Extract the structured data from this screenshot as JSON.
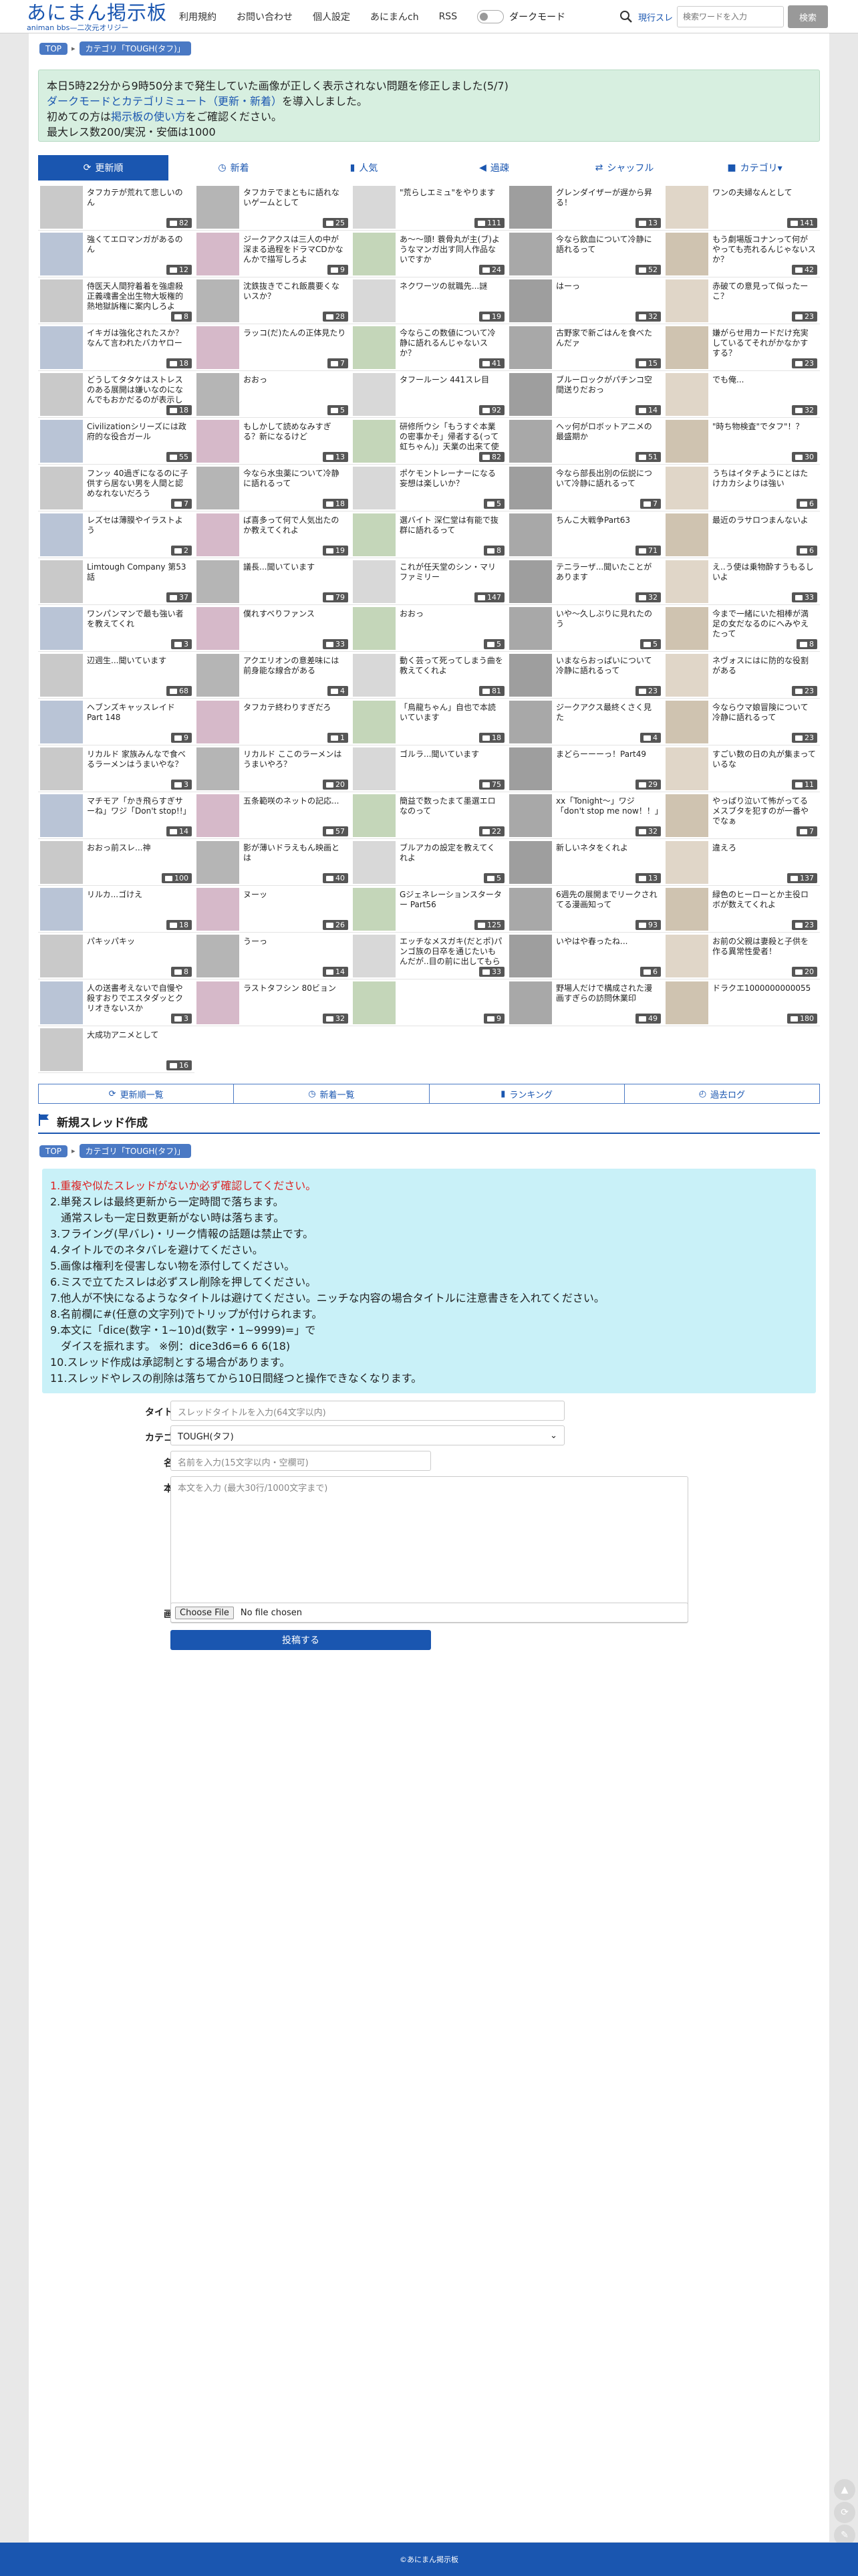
{
  "header": {
    "logo_title": "あにまん掲示板",
    "logo_subtitle": "animan bbs—二次元オリジー",
    "nav": [
      {
        "label": "利用規約"
      },
      {
        "label": "お問い合わせ"
      },
      {
        "label": "個人設定"
      },
      {
        "label": "あにまんch"
      },
      {
        "label": "RSS"
      }
    ],
    "darkmode_label": "ダークモード",
    "search": {
      "scope_label": "現行スレ",
      "placeholder": "検索ワードを入力",
      "button_label": "検索"
    }
  },
  "breadcrumb": {
    "top": "TOP",
    "category": "カテゴリ「TOUGH(タフ)」"
  },
  "notice": {
    "line1": "本日5時22分から9時50分まで発生していた画像が正しく表示されない問題を修正しました(5/7)",
    "line2_link": "ダークモードとカテゴリミュート（更新・新着）",
    "line2_text": "を導入しました。",
    "line3_pre": "初めての方は",
    "line3_link": "掲示板の使い方",
    "line3_post": "をご確認ください。",
    "line4": "最大レス数200/実況・安価は1000"
  },
  "tabs": [
    {
      "label": "更新順",
      "icon": "refresh-icon"
    },
    {
      "label": "新着",
      "icon": "clock-icon"
    },
    {
      "label": "人気",
      "icon": "bar-chart-icon"
    },
    {
      "label": "過疎",
      "icon": "speaker-icon"
    },
    {
      "label": "シャッフル",
      "icon": "shuffle-icon"
    },
    {
      "label": "カテゴリ▾",
      "icon": "folder-icon"
    }
  ],
  "threads": [
    {
      "title": "タフカテが荒れて悲しいのん",
      "count": "82"
    },
    {
      "title": "タフカテでまともに語れないゲームとして",
      "count": "25"
    },
    {
      "title": "\"荒らしエミュ\"をやります",
      "count": "111"
    },
    {
      "title": "グレンダイザーが遅から昇る！",
      "count": "13"
    },
    {
      "title": "ワンの夫婦なんとして",
      "count": "141"
    },
    {
      "title": "強くてエロマンガがあるのん",
      "count": "12"
    },
    {
      "title": "ジークアクスは三人の中が深まる過程をドラマCDかなんかで描写しろよ",
      "count": "9"
    },
    {
      "title": "あ～～頭! 蓑骨丸が主(ブ)ようなマンガ出す同人作品ないですか",
      "count": "24"
    },
    {
      "title": "今なら飲血について冷静に語れるって",
      "count": "52"
    },
    {
      "title": "もう劇場版コナンって何がやっても売れるんじゃないスか？",
      "count": "42"
    },
    {
      "title": "侍医天人間狩着着を強虐殺正義魂書全出生物大坂権的熱地獄訴権に案内しろよ",
      "count": "8"
    },
    {
      "title": "沈鉄抜きでこれ飯農要くないスか？",
      "count": "28"
    },
    {
      "title": "ネクワーツの就職先...謎",
      "count": "19"
    },
    {
      "title": "はーっ",
      "count": "32"
    },
    {
      "title": "赤破ての意見って似ったーこ？",
      "count": "23"
    },
    {
      "title": "イキガは強化されたスか？なんて言われたバカヤロー",
      "count": "18"
    },
    {
      "title": "ラッコ(だ)たんの正体見たり",
      "count": "7"
    },
    {
      "title": "今ならこの数値について冷静に語れるんじゃないスか？",
      "count": "41"
    },
    {
      "title": "古野家で新ごはんを食べたんだァ",
      "count": "15"
    },
    {
      "title": "嫌がらせ用カードだけ充実しているてそれがかなかすする？",
      "count": "23"
    },
    {
      "title": "どうしてタタケはストレスのある展開は嫌いなのになんでもおかだるのが表示してくれる",
      "count": "18"
    },
    {
      "title": "おおっ",
      "count": "5"
    },
    {
      "title": "タフールーン 441スレ目",
      "count": "92"
    },
    {
      "title": "ブルーロックがパチンコ空間送りだおっ",
      "count": "14"
    },
    {
      "title": "でも俺...",
      "count": "32"
    },
    {
      "title": "Civilizationシリーズには政府的な役合ガール",
      "count": "55"
    },
    {
      "title": "もしかして読めなみすぎる？新になるけど",
      "count": "13"
    },
    {
      "title": "研修所ウシ「もうすぐ本業の密事かそ」帰者する(って虹ちゃん)」天業の出来て使用結業ガーて...",
      "count": "82"
    },
    {
      "title": "ヘッ何がロボットアニメの最盛期か",
      "count": "51"
    },
    {
      "title": "\"時ち物検査\"でタフ\"！？",
      "count": "30"
    },
    {
      "title": "フンッ 40過ぎになるのに子供すら居ない男を人間と認めなれないだろう",
      "count": "7"
    },
    {
      "title": "今なら水虫薬について冷静に語れるって",
      "count": "18"
    },
    {
      "title": "ポケモントレーナーになる妄想は楽しいか？",
      "count": "5"
    },
    {
      "title": "今なら部長出別の伝説について冷静に語れるって",
      "count": "7"
    },
    {
      "title": "うちはイタチようにとはたけカカシよりは強い",
      "count": "6"
    },
    {
      "title": "レズセは薄膜やイラストよう",
      "count": "2"
    },
    {
      "title": "ぱ喜多って何で人気出たのか教えてくれよ",
      "count": "19"
    },
    {
      "title": "選バイト 深仁堂は有能で抜群に語れるって",
      "count": "8"
    },
    {
      "title": "ちんこ大戦争Part63",
      "count": "71"
    },
    {
      "title": "最近のラサロつまんないよ",
      "count": "6"
    },
    {
      "title": "Limtough Company 第53話",
      "count": "37"
    },
    {
      "title": "議長...聞いています",
      "count": "79"
    },
    {
      "title": "これが任天堂のシン・マリファミリー",
      "count": "147"
    },
    {
      "title": "テニラーザ...聞いたことがあります",
      "count": "32"
    },
    {
      "title": "え..う使は乗物酔すうもるしいよ",
      "count": "33"
    },
    {
      "title": "ワンパンマンで最も強い者を教えてくれ",
      "count": "3"
    },
    {
      "title": "僕れすべりファンス",
      "count": "33"
    },
    {
      "title": "おおっ",
      "count": "5"
    },
    {
      "title": "いや～久しぶりに見れたのう",
      "count": "5"
    },
    {
      "title": "今まで一緒にいた相棒が満足の女だなるのにへみやえたって",
      "count": "8"
    },
    {
      "title": "辺週生...聞いています",
      "count": "68"
    },
    {
      "title": "アクエリオンの意差味には前身能な線合がある",
      "count": "4"
    },
    {
      "title": "動く芸って死ってしまう曲を教えてくれよ",
      "count": "81"
    },
    {
      "title": "いまならおっぱいについて冷静に語れるって",
      "count": "23"
    },
    {
      "title": "ネヴォスにはに防的な役割がある",
      "count": "23"
    },
    {
      "title": "ヘブンズキャッスレイド Part 148",
      "count": "9"
    },
    {
      "title": "タフカテ終わりすぎだろ",
      "count": "1"
    },
    {
      "title": "「鳥龍ちゃん」自也で本読いています",
      "count": "18"
    },
    {
      "title": "ジークアクス最終くさく見た",
      "count": "4"
    },
    {
      "title": "今ならウマ娘冒険について冷静に語れるって",
      "count": "23"
    },
    {
      "title": "リカルド 家族みんなで食べるラーメンはうまいやな？",
      "count": "3"
    },
    {
      "title": "リカルド ここのラーメンはうまいやろ？",
      "count": "20"
    },
    {
      "title": "ゴルラ...聞いています",
      "count": "75"
    },
    {
      "title": "まどらーーーっ！Part49",
      "count": "29"
    },
    {
      "title": "すごい数の日の丸が集まっているな",
      "count": "11"
    },
    {
      "title": "マチモア「かき飛らすぎサーね」ワジ「Don't stop!!」",
      "count": "14"
    },
    {
      "title": "五条範咲のネットの記応...",
      "count": "57"
    },
    {
      "title": "簡益で数ったまて墨選エロなのって",
      "count": "22"
    },
    {
      "title": "xx「Tonight～」ワジ「don't stop me now！！」",
      "count": "32"
    },
    {
      "title": "やっぱり泣いて怖がってるメスブタを犯すのが一番やでなぁ",
      "count": "7"
    },
    {
      "title": "おおっ前スレ...神",
      "count": "100"
    },
    {
      "title": "影が薄いドラえもん映画とは",
      "count": "40"
    },
    {
      "title": "ブルアカの設定を教えてくれよ",
      "count": "5"
    },
    {
      "title": "新しいネタをくれよ",
      "count": "13"
    },
    {
      "title": "違えろ",
      "count": "137"
    },
    {
      "title": "リルカ...ゴけえ",
      "count": "18"
    },
    {
      "title": "ヌーッ",
      "count": "26"
    },
    {
      "title": "Gジェネレーションスターター Part56",
      "count": "125"
    },
    {
      "title": "6週先の展開までリークされてる漫画知って",
      "count": "93"
    },
    {
      "title": "緑色のヒーローとか主役ロボが数えてくれよ",
      "count": "23"
    },
    {
      "title": "パキッパキッ",
      "count": "8"
    },
    {
      "title": "うーっ",
      "count": "14"
    },
    {
      "title": "エッチなメスガキ(だとポ)パンゴ族の日卒を通じたいもんだが..目の前に出してもらえるのか",
      "count": "33"
    },
    {
      "title": "いやはや春ったね...",
      "count": "6"
    },
    {
      "title": "お前の父親は妻殺と子供を作る異常性愛者！",
      "count": "20"
    },
    {
      "title": "人の送書考えないで自慢や殺すおりでエスタダッとクリオきないスか",
      "count": "3"
    },
    {
      "title": "ラストタフシン 80ビョン",
      "count": "32"
    },
    {
      "title": "",
      "count": "9"
    },
    {
      "title": "野場人だけで構成された漫画すぎらの訪問休業印",
      "count": "49"
    },
    {
      "title": "ドラクエ1000000000055",
      "count": "180"
    },
    {
      "title": "大成功アニメとして",
      "count": "16"
    }
  ],
  "bottom_links": [
    {
      "label": "更新順一覧",
      "icon": "refresh-icon"
    },
    {
      "label": "新着一覧",
      "icon": "clock-icon"
    },
    {
      "label": "ランキング",
      "icon": "bar-chart-icon"
    },
    {
      "label": "過去ログ",
      "icon": "history-icon"
    }
  ],
  "new_thread": {
    "heading": "新規スレッド作成",
    "rules": [
      {
        "text": "1.重複や似たスレッドがないか必ず確認してください。",
        "tone": "red"
      },
      {
        "text": "2.単発スレは最終更新から一定時間で落ちます。",
        "tone": "normal"
      },
      {
        "text": "　通常スレも一定日数更新がない時は落ちます。",
        "tone": "normal"
      },
      {
        "text": "3.フライング(早バレ)・リーク情報の話題は禁止です。",
        "tone": "normal"
      },
      {
        "text": "4.タイトルでのネタバレを避けてください。",
        "tone": "normal"
      },
      {
        "text": "5.画像は権利を侵害しない物を添付してください。",
        "tone": "normal"
      },
      {
        "text": "6.ミスで立てたスレは必ずスレ削除を押してください。",
        "tone": "normal"
      },
      {
        "text": "7.他人が不快になるようなタイトルは避けてください。ニッチな内容の場合タイトルに注意書きを入れてください。",
        "tone": "normal"
      },
      {
        "text": "8.名前欄に#(任意の文字列)でトリップが付けられます。",
        "tone": "normal"
      },
      {
        "text": "9.本文に「dice(数字・1~10)d(数字・1~9999)=」で",
        "tone": "normal"
      },
      {
        "text": "　ダイスを振れます。 ※例：dice3d6=6 6 6(18)",
        "tone": "normal"
      },
      {
        "text": "10.スレッド作成は承認制とする場合があります。",
        "tone": "normal"
      },
      {
        "text": "11.スレッドやレスの削除は落ちてから10日間経つと操作できなくなります。",
        "tone": "normal"
      }
    ],
    "form": {
      "title_label": "タイトル",
      "title_placeholder": "スレッドタイトルを入力(64文字以内)",
      "category_label": "カテゴリ",
      "category_value": "TOUGH(タフ)",
      "name_label": "名前",
      "name_placeholder": "名前を入力(15文字以内・空欄可)",
      "body_label": "本文",
      "body_placeholder": "本文を入力 (最大30行/1000文字まで)",
      "image_label": "画像",
      "file_button": "Choose File",
      "file_status": "No file chosen",
      "submit_label": "投稿する"
    }
  },
  "footer": {
    "copyright": "©あにまん掲示板"
  },
  "colors": {
    "brand": "#1a56b0",
    "notice_bg": "#d7efe0",
    "rules_bg": "#c9f1f8",
    "danger": "#d22222"
  }
}
